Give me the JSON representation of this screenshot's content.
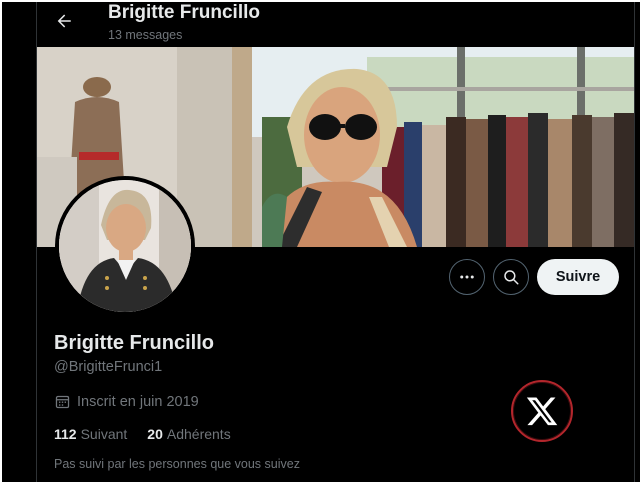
{
  "header": {
    "name": "Brigitte Fruncillo",
    "post_count": "13 messages"
  },
  "actions": {
    "more_icon": "more-dots-icon",
    "search_icon": "search-icon",
    "follow_label": "Suivre"
  },
  "profile": {
    "display_name": "Brigitte Fruncillo",
    "handle": "@BrigitteFrunci1",
    "joined_icon": "calendar-icon",
    "joined": "Inscrit en juin 2019",
    "following_count": "112",
    "following_label": "Suivant",
    "followers_count": "20",
    "followers_label": "Adhérents",
    "not_followed_text": "Pas suivi par les personnes que vous suivez"
  },
  "logo": {
    "icon": "x-logo-icon",
    "border_color": "#b3262c"
  },
  "colors": {
    "background": "#000000",
    "text_primary": "#e7e9ea",
    "text_secondary": "#71767b",
    "follow_button_bg": "#eff3f4"
  }
}
